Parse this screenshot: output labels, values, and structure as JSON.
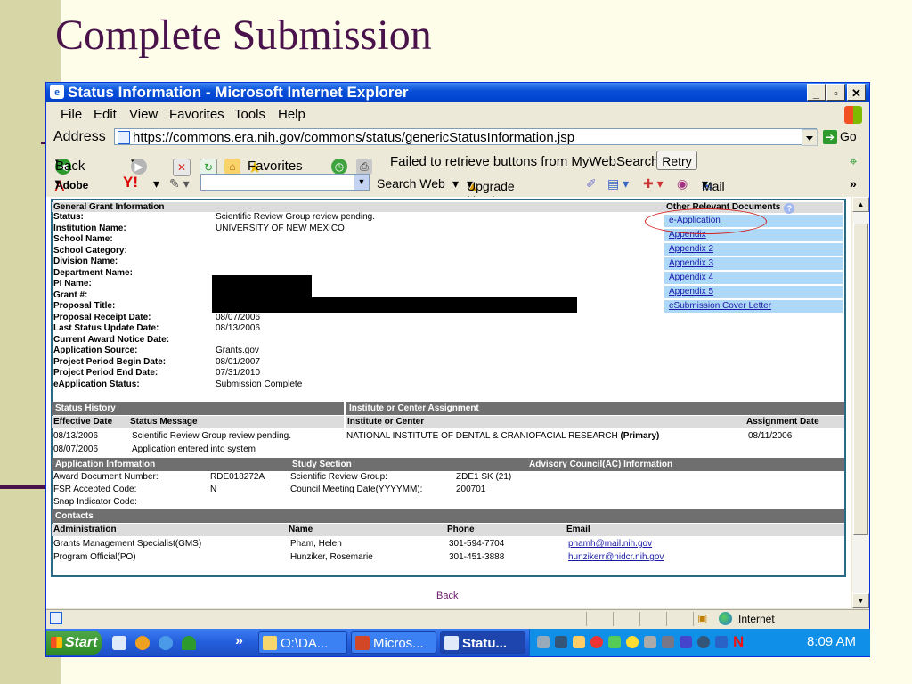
{
  "slide": {
    "title": "Complete Submission"
  },
  "window": {
    "title": "Status Information - Microsoft Internet Explorer",
    "min": "_",
    "max": "▫",
    "close": "✕",
    "menu": [
      "File",
      "Edit",
      "View",
      "Favorites",
      "Tools",
      "Help"
    ],
    "address_label": "Address",
    "url": "https://commons.era.nih.gov/commons/status/genericStatusInformation.jsp",
    "go_label": "Go",
    "toolbar": {
      "back": "Back",
      "favorites": "Favorites",
      "message": "Failed to retrieve buttons from MyWebSearch.",
      "retry": "Retry"
    },
    "yahoo": {
      "adobe": "Adobe",
      "y": "Y!",
      "search_web": "Search Web",
      "upgrade": "Upgrade Now!",
      "mail": "Mail",
      "more": "»"
    }
  },
  "general": {
    "heading": "General Grant Information",
    "rows": [
      {
        "k": "Status:",
        "v": "Scientific Review Group review pending."
      },
      {
        "k": "Institution Name:",
        "v": "UNIVERSITY OF NEW MEXICO"
      },
      {
        "k": "School Name:",
        "v": ""
      },
      {
        "k": "School Category:",
        "v": ""
      },
      {
        "k": "Division Name:",
        "v": ""
      },
      {
        "k": "Department Name:",
        "v": ""
      },
      {
        "k": "PI Name:",
        "v": ""
      },
      {
        "k": "Grant #:",
        "v": ""
      },
      {
        "k": "Proposal Title:",
        "v": ""
      },
      {
        "k": "Proposal Receipt Date:",
        "v": "08/07/2006"
      },
      {
        "k": "Last Status Update Date:",
        "v": "08/13/2006"
      },
      {
        "k": "Current Award Notice Date:",
        "v": ""
      },
      {
        "k": "Application Source:",
        "v": "Grants.gov"
      },
      {
        "k": "Project Period Begin Date:",
        "v": "08/01/2007"
      },
      {
        "k": "Project Period End Date:",
        "v": "07/31/2010"
      },
      {
        "k": "eApplication Status:",
        "v": "Submission Complete"
      }
    ]
  },
  "other_docs": {
    "heading": "Other Relevant Documents",
    "help": "?",
    "links": [
      "e-Application",
      "Appendix",
      "Appendix 2",
      "Appendix 3",
      "Appendix 4",
      "Appendix 5",
      "eSubmission Cover Letter"
    ]
  },
  "status_history": {
    "heading": "Status History",
    "col_date": "Effective Date",
    "col_msg": "Status Message",
    "rows": [
      {
        "date": "08/13/2006",
        "msg": "Scientific Review Group review pending."
      },
      {
        "date": "08/07/2006",
        "msg": "Application entered into system"
      }
    ]
  },
  "assignment": {
    "heading": "Institute or Center Assignment",
    "col_ic": "Institute or Center",
    "col_date": "Assignment Date",
    "ic": "NATIONAL INSTITUTE OF DENTAL & CRANIOFACIAL RESEARCH",
    "primary": "(Primary)",
    "date": "08/11/2006"
  },
  "application_info": {
    "heading": "Application Information",
    "rows": [
      {
        "k": "Award Document Number:",
        "v": "RDE018272A"
      },
      {
        "k": "FSR Accepted Code:",
        "v": "N"
      },
      {
        "k": "Snap Indicator Code:",
        "v": ""
      }
    ]
  },
  "study_section": {
    "heading": "Study Section",
    "rows": [
      {
        "k": "Scientific Review Group:",
        "v": "ZDE1 SK (21)"
      },
      {
        "k": "Council Meeting Date(YYYYMM):",
        "v": "200701"
      }
    ]
  },
  "advisory": {
    "heading": "Advisory Council(AC) Information"
  },
  "contacts": {
    "heading": "Contacts",
    "cols": [
      "Administration",
      "Name",
      "Phone",
      "Email"
    ],
    "rows": [
      {
        "role": "Grants Management Specialist(GMS)",
        "name": "Pham, Helen",
        "phone": "301-594-7704",
        "email": "phamh@mail.nih.gov"
      },
      {
        "role": "Program Official(PO)",
        "name": "Hunziker, Rosemarie",
        "phone": "301-451-3888",
        "email": "hunzikerr@nidcr.nih.gov"
      }
    ]
  },
  "back_label": "Back",
  "statusbar": {
    "zone": "Internet"
  },
  "taskbar": {
    "start": "Start",
    "chevron": "»",
    "tasks": [
      "O:\\DA...",
      "Micros...",
      "Statu..."
    ],
    "clock": "8:09 AM"
  }
}
